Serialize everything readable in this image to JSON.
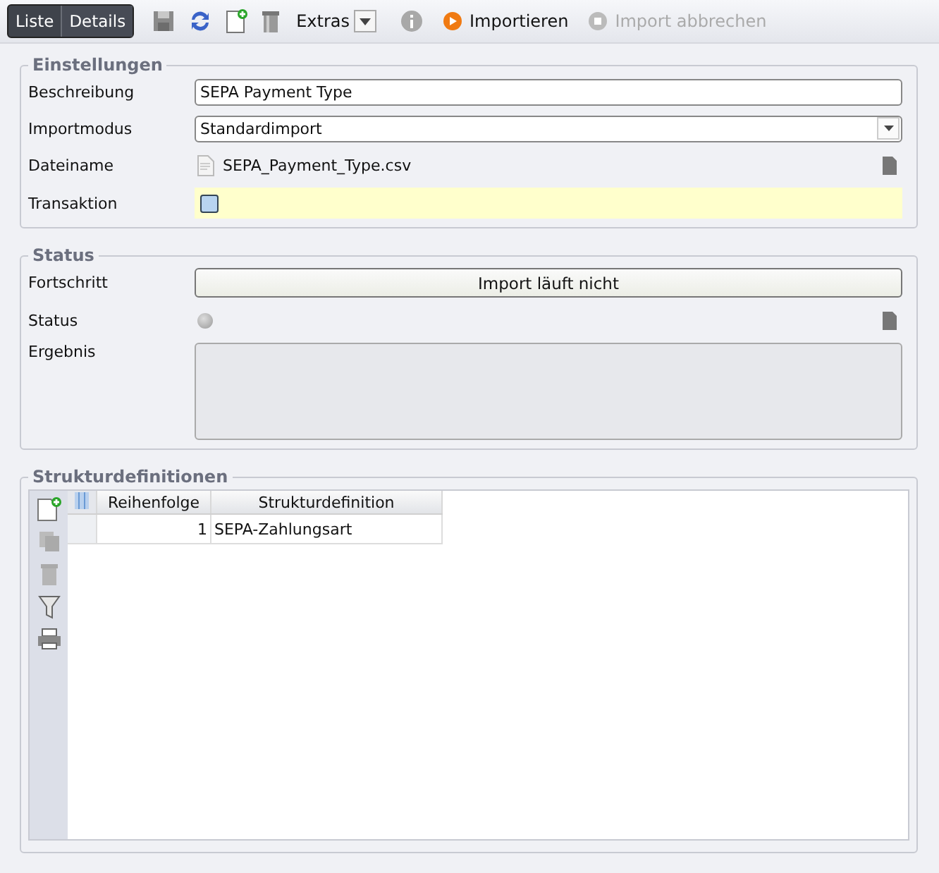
{
  "toolbar": {
    "breadcrumb": [
      {
        "label": "Liste",
        "selected": false
      },
      {
        "label": "Details",
        "selected": true
      }
    ],
    "extras": {
      "label": "Extras"
    },
    "actions": [
      {
        "label": "Importieren",
        "disabled": false
      },
      {
        "label": "Import abbrechen",
        "disabled": true
      }
    ]
  },
  "einstellungen": {
    "title": "Einstellungen",
    "beschreibung": {
      "label": "Beschreibung",
      "value": "SEPA Payment Type"
    },
    "importmodus": {
      "label": "Importmodus",
      "value": "Standardimport"
    },
    "dateiname": {
      "label": "Dateiname",
      "value": "SEPA_Payment_Type.csv"
    },
    "transaktion": {
      "label": "Transaktion",
      "checked": false
    }
  },
  "status": {
    "title": "Status",
    "fortschritt": {
      "label": "Fortschritt",
      "value": "Import läuft nicht"
    },
    "status": {
      "label": "Status"
    },
    "ergebnis": {
      "label": "Ergebnis"
    }
  },
  "strukturdefinitionen": {
    "title": "Strukturdefinitionen",
    "columns": [
      "Reihenfolge",
      "Strukturdefinition"
    ],
    "rows": [
      {
        "cells": [
          "1",
          "SEPA-Zahlungsart"
        ],
        "selected": false
      }
    ]
  }
}
